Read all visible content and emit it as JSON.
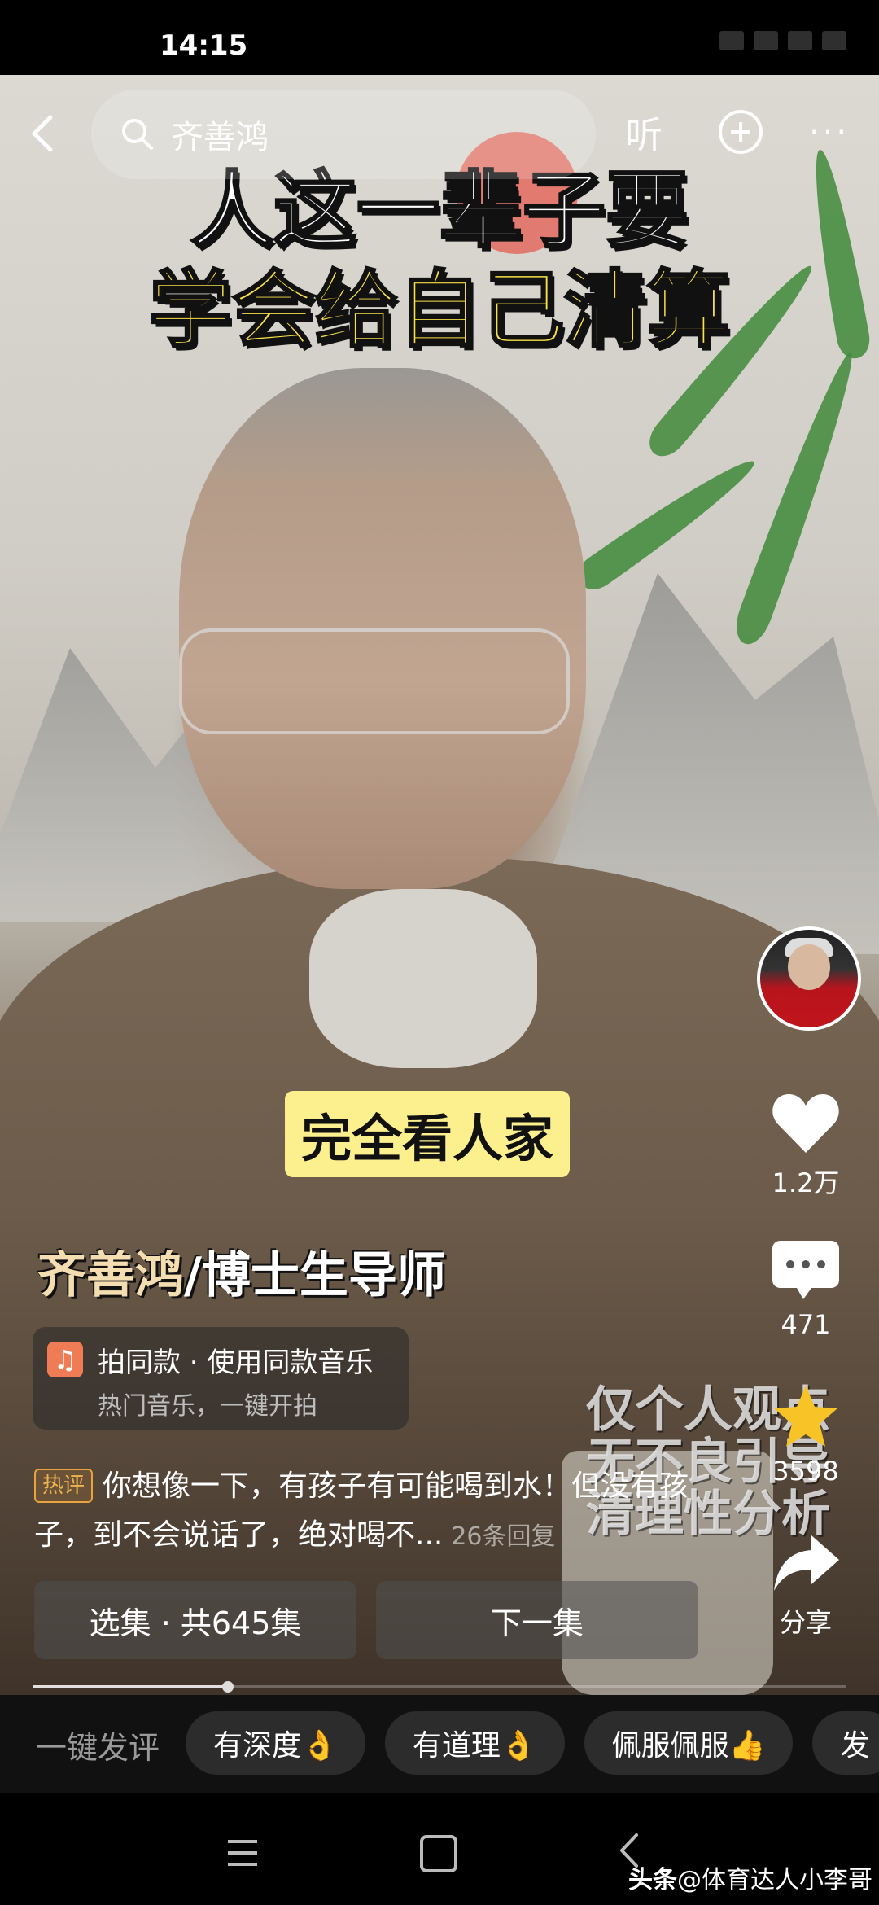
{
  "status_bar": {
    "time": "14:15"
  },
  "top_bar": {
    "search_text": "齐善鸿",
    "listen_label": "听",
    "more_label": "···"
  },
  "video": {
    "headline_line1": "人这一辈子要",
    "headline_line2": "学会给自己清算",
    "subtitle": "完全看人家",
    "name_caption_name": "齐善鸿",
    "name_caption_suffix": "/博士生导师",
    "watermark": "仅个人观点\n无不良引导\n清理性分析"
  },
  "actions": {
    "like_count": "1.2万",
    "comment_count": "471",
    "favorite_count": "3598",
    "share_label": "分享"
  },
  "music_card": {
    "title": "拍同款 · 使用同款音乐",
    "subtitle": "热门音乐，一键开拍"
  },
  "hot_comment": {
    "tag": "热评",
    "text": "你想像一下，有孩子有可能喝到水！但没有孩子，到不会说话了，绝对喝不...",
    "reply_count": "26条回复"
  },
  "episode_nav": {
    "episodes_label": "选集 · 共645集",
    "next_label": "下一集"
  },
  "progress": {
    "fraction": 0.24
  },
  "quick_comment": {
    "label": "一键发评",
    "chips": [
      "有深度👌",
      "有道理👌",
      "佩服佩服👍",
      "发"
    ]
  },
  "footer": {
    "credit_app": "头条",
    "credit_user": "@体育达人小李哥"
  }
}
